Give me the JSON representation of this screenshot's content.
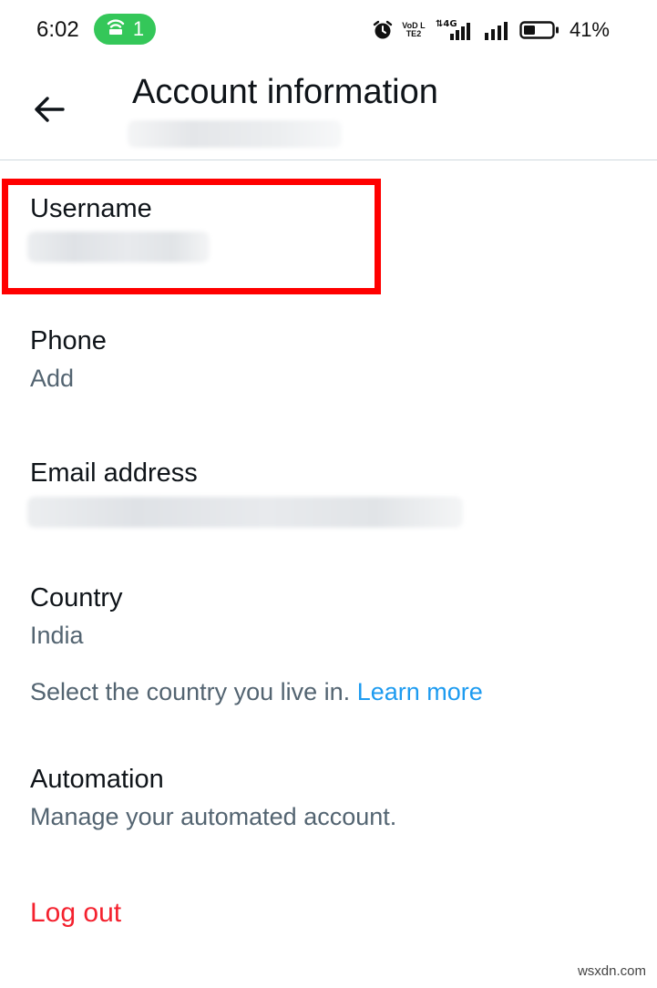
{
  "status_bar": {
    "time": "6:02",
    "hotspot_count": "1",
    "network": "4G",
    "volte": "VoD LTE2",
    "battery_percent": "41%",
    "battery_level": 0.41
  },
  "header": {
    "title": "Account information",
    "subtitle_blurred": true
  },
  "fields": {
    "username": {
      "label": "Username",
      "value_blurred": true
    },
    "phone": {
      "label": "Phone",
      "value": "Add"
    },
    "email": {
      "label": "Email address",
      "value_blurred": true
    },
    "country": {
      "label": "Country",
      "value": "India",
      "note": "Select the country you live in.",
      "link": "Learn more"
    },
    "automation": {
      "label": "Automation",
      "value": "Manage your automated account."
    }
  },
  "logout_label": "Log out",
  "watermark": "wsxdn.com",
  "colors": {
    "accent_link": "#1d9bf0",
    "logout": "#f4212e",
    "highlight": "#ff0000",
    "secondary_text": "#536471",
    "hotspot": "#34c759"
  }
}
